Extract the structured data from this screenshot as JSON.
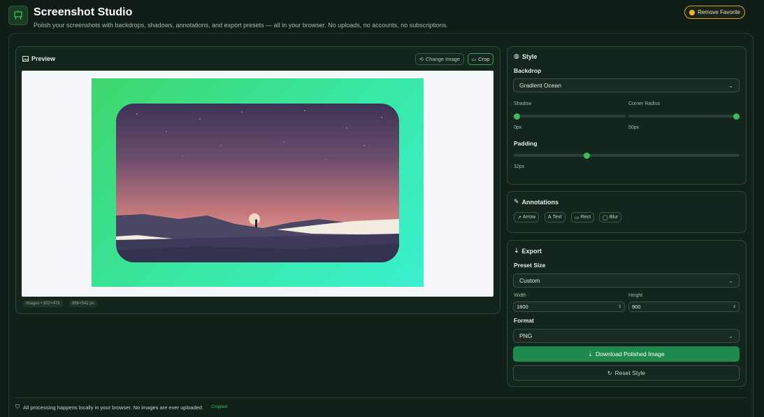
{
  "header": {
    "title": "Screenshot Studio",
    "subtitle": "Polish your screenshots with backdrops, shadows, annotations, and export presets — all in your browser. No uploads, no accounts, no subscriptions.",
    "favorite_label": "Remove Favorite"
  },
  "preview": {
    "title": "Preview",
    "change_image_label": "Change Image",
    "crop_label": "Crop",
    "image_meta": "Images • 802×478",
    "output_meta": "866×542 px"
  },
  "style": {
    "title": "Style",
    "backdrop_label": "Backdrop",
    "backdrop_value": "Gradient Ocean",
    "shadow_label": "Shadow",
    "shadow_value": "0px",
    "shadow_level": 0,
    "radius_label": "Corner Radius",
    "radius_value": "50px",
    "radius_level": 1,
    "padding_label": "Padding",
    "padding_value": "32px",
    "padding_level": 0.32
  },
  "annotations": {
    "title": "Annotations",
    "tools": [
      {
        "icon": "arrow-icon",
        "label": "Arrow"
      },
      {
        "icon": "text-icon",
        "label": "Text"
      },
      {
        "icon": "rect-icon",
        "label": "Rect"
      },
      {
        "icon": "blur-icon",
        "label": "Blur"
      }
    ]
  },
  "export": {
    "title": "Export",
    "preset_label": "Preset Size",
    "preset_value": "Custom",
    "width_label": "Width",
    "width_value": "1800",
    "height_label": "Height",
    "height_value": "900",
    "format_label": "Format",
    "format_value": "PNG",
    "download_label": "Download Polished Image",
    "reset_label": "Reset Style"
  },
  "footer": {
    "text": "All processing happens locally in your browser. No images are ever uploaded.",
    "status": "Cropped"
  },
  "colors": {
    "accent": "#3dbd5a",
    "primary_button": "#1e8a4e",
    "favorite_border": "#d8a41a",
    "background": "#0f1d16"
  }
}
